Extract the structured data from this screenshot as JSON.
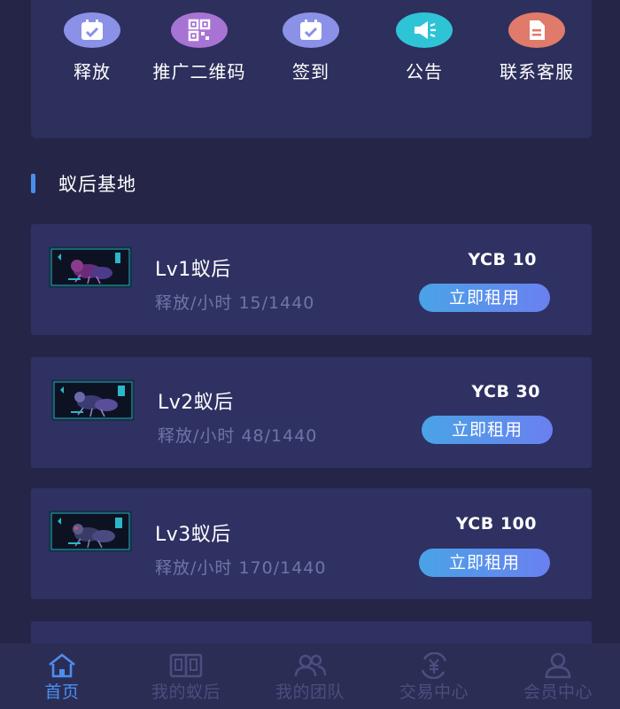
{
  "quick_actions": [
    {
      "label": "释放",
      "icon": "calendar-check-icon",
      "color": "#8a91e6"
    },
    {
      "label": "推广二维码",
      "icon": "qr-code-icon",
      "color": "#a874d4"
    },
    {
      "label": "签到",
      "icon": "calendar-check-icon",
      "color": "#8a91e6"
    },
    {
      "label": "公告",
      "icon": "megaphone-icon",
      "color": "#2ec4d6"
    },
    {
      "label": "联系客服",
      "icon": "document-icon",
      "color": "#e07a6a"
    }
  ],
  "section": {
    "title": "蚁后基地"
  },
  "cards": [
    {
      "name": "Lv1蚁后",
      "rate": "释放/小时 15/1440",
      "price": "YCB 10",
      "button": "立即租用",
      "image": "ant-queen-thumbnail"
    },
    {
      "name": "Lv2蚁后",
      "rate": "释放/小时 48/1440",
      "price": "YCB 30",
      "button": "立即租用",
      "image": "ant-queen-thumbnail"
    },
    {
      "name": "Lv3蚁后",
      "rate": "释放/小时 170/1440",
      "price": "YCB 100",
      "button": "立即租用",
      "image": "ant-queen-thumbnail"
    }
  ],
  "nav": {
    "items": [
      {
        "label": "首页",
        "icon": "home-icon",
        "active": true
      },
      {
        "label": "我的蚁后",
        "icon": "book-icon",
        "active": false
      },
      {
        "label": "我的团队",
        "icon": "team-icon",
        "active": false
      },
      {
        "label": "交易中心",
        "icon": "yuan-exchange-icon",
        "active": false
      },
      {
        "label": "会员中心",
        "icon": "user-icon",
        "active": false
      }
    ]
  },
  "colors": {
    "accent": "#4a8ff0",
    "background": "#252647",
    "card": "#2f3163",
    "muted": "#6f74a6",
    "nav_inactive": "#4b4e7e"
  }
}
